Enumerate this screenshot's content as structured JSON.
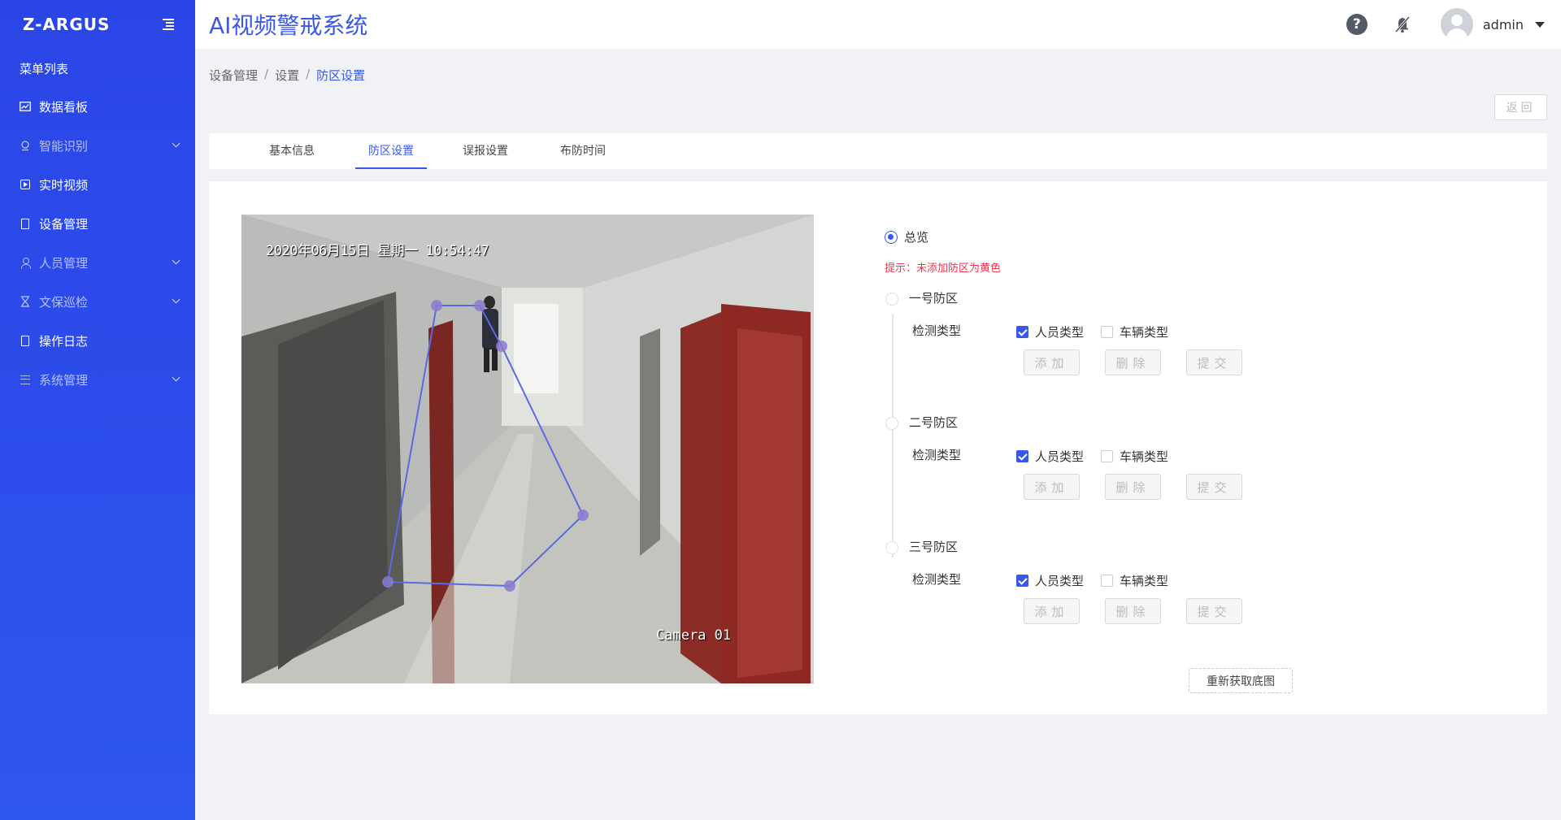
{
  "sidebar": {
    "logo": "Z-ARGUS",
    "menu_title": "菜单列表",
    "items": [
      {
        "label": "数据看板",
        "icon": "chart-icon"
      },
      {
        "label": "智能识别",
        "icon": "camera-icon",
        "expandable": true
      },
      {
        "label": "实时视频",
        "icon": "play-icon"
      },
      {
        "label": "设备管理",
        "icon": "device-icon"
      },
      {
        "label": "人员管理",
        "icon": "user-icon",
        "expandable": true
      },
      {
        "label": "文保巡检",
        "icon": "hourglass-icon",
        "expandable": true
      },
      {
        "label": "操作日志",
        "icon": "log-icon"
      },
      {
        "label": "系统管理",
        "icon": "list-icon",
        "expandable": true
      }
    ]
  },
  "header": {
    "title": "AI视频警戒系统",
    "username": "admin"
  },
  "breadcrumb": [
    "设备管理",
    "设置",
    "防区设置"
  ],
  "back_label": "返回",
  "tabs": [
    "基本信息",
    "防区设置",
    "误报设置",
    "布防时间"
  ],
  "active_tab": "防区设置",
  "video": {
    "timestamp": "2020年06月15日 星期一 10:54:47",
    "camera_label": "Camera 01"
  },
  "overview_label": "总览",
  "hint": "提示：未添加防区为黄色",
  "zones": [
    {
      "name": "一号防区",
      "detect_label": "检测类型",
      "person": {
        "label": "人员类型",
        "checked": true
      },
      "vehicle": {
        "label": "车辆类型",
        "checked": false
      }
    },
    {
      "name": "二号防区",
      "detect_label": "检测类型",
      "person": {
        "label": "人员类型",
        "checked": true
      },
      "vehicle": {
        "label": "车辆类型",
        "checked": false
      }
    },
    {
      "name": "三号防区",
      "detect_label": "检测类型",
      "person": {
        "label": "人员类型",
        "checked": true
      },
      "vehicle": {
        "label": "车辆类型",
        "checked": false
      }
    }
  ],
  "buttons": {
    "add": "添加",
    "delete": "删除",
    "submit": "提交"
  },
  "refetch_label": "重新获取底图",
  "colors": {
    "primary": "#3a57e8",
    "sidebar": "#2a45e6",
    "hint": "#f5334e"
  }
}
